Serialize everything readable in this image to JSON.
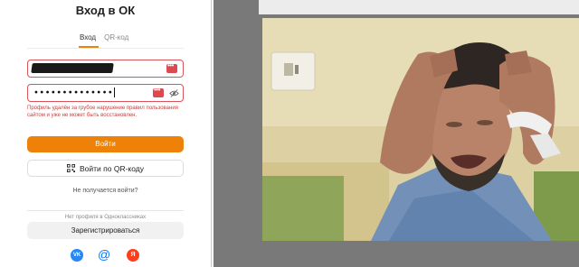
{
  "login": {
    "title": "Вход в ОК",
    "tabs": [
      {
        "label": "Вход",
        "active": true
      },
      {
        "label": "QR-код",
        "active": false
      }
    ],
    "password_value": "••••••••••••••",
    "error_text": "Профиль удалён за грубое нарушение правил пользования сайтом и уже не может быть восстановлен.",
    "submit_label": "Войти",
    "qr_button_label": "Войти по QR-коду",
    "trouble_link": "Не получается войти?",
    "no_profile_text": "Нет профиля в Одноклассниках",
    "register_label": "Зарегистрироваться",
    "social": [
      {
        "name": "vk",
        "label": "VK"
      },
      {
        "name": "mail",
        "label": "@"
      },
      {
        "name": "yandex",
        "label": "Я"
      }
    ]
  },
  "colors": {
    "accent": "#ee8208",
    "error": "#c8413f",
    "field_border": "#d8535a",
    "viewer_bg": "#797979"
  },
  "icons": [
    "eye-icon",
    "qr-code-icon",
    "vk-icon",
    "mail-icon",
    "yandex-icon",
    "password-manager-icon"
  ]
}
